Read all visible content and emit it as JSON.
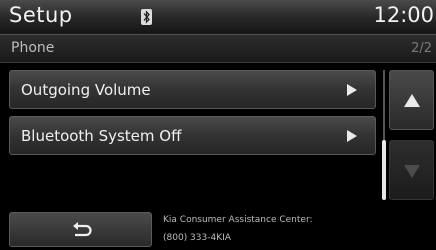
{
  "status_bar": {
    "title": "Setup",
    "bluetooth_icon": "bluetooth-icon",
    "clock": "12:00"
  },
  "subheader": {
    "title": "Phone",
    "page_indicator": "2/2"
  },
  "menu": {
    "items": [
      {
        "label": "Outgoing Volume",
        "icon": "arrow-right-icon"
      },
      {
        "label": "Bluetooth System Off",
        "icon": "arrow-right-icon"
      }
    ]
  },
  "scroll": {
    "up_icon": "scroll-up-icon",
    "down_icon": "scroll-down-icon",
    "down_enabled": false
  },
  "footer": {
    "back_icon": "back-icon",
    "assistance_line1": "Kia Consumer Assistance Center:",
    "assistance_line2": "(800) 333-4KIA"
  }
}
